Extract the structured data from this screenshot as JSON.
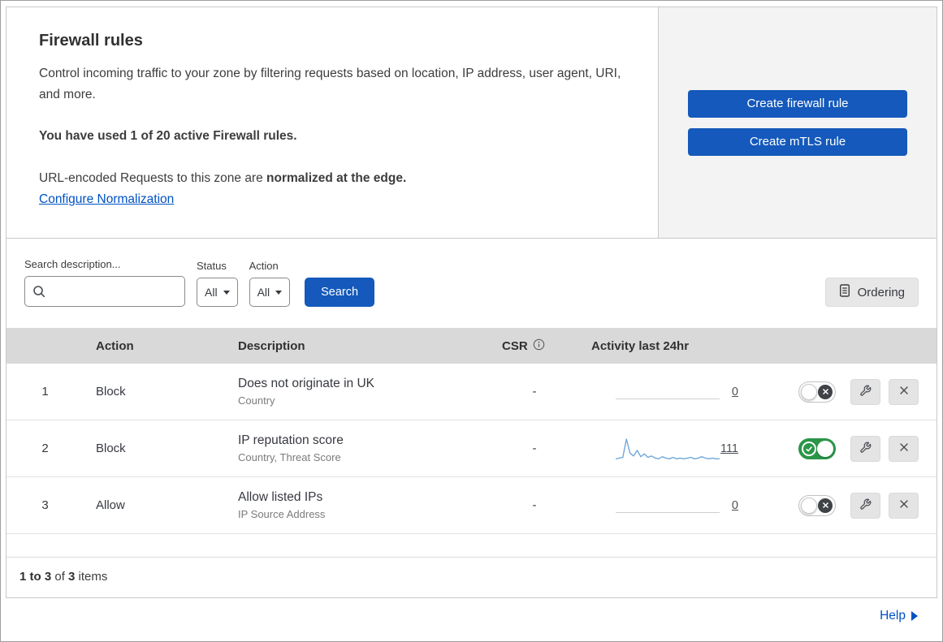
{
  "intro": {
    "title": "Firewall rules",
    "description": "Control incoming traffic to your zone by filtering requests based on location, IP address, user agent, URI, and more.",
    "usage_note": "You have used 1 of 20 active Firewall rules.",
    "normalization_prefix": "URL-encoded Requests to this zone are ",
    "normalization_bold": "normalized at the edge.",
    "normalization_link_label": "Configure Normalization"
  },
  "actions_panel": {
    "create_firewall_rule_label": "Create firewall rule",
    "create_mtls_rule_label": "Create mTLS rule"
  },
  "filters": {
    "search_label": "Search description...",
    "search_value": "",
    "status_label": "Status",
    "status_value": "All",
    "action_label": "Action",
    "action_value": "All",
    "search_button_label": "Search",
    "ordering_button_label": "Ordering"
  },
  "table": {
    "headers": {
      "action": "Action",
      "description": "Description",
      "csr": "CSR",
      "activity": "Activity last 24hr"
    },
    "rows": [
      {
        "num": "1",
        "action": "Block",
        "description": "Does not originate in UK",
        "match_fields": "Country",
        "csr": "-",
        "activity_count": "0",
        "enabled": false,
        "sparkline": []
      },
      {
        "num": "2",
        "action": "Block",
        "description": "IP reputation score",
        "match_fields": "Country, Threat Score",
        "csr": "-",
        "activity_count": "111",
        "enabled": true,
        "sparkline": [
          2,
          3,
          4,
          30,
          10,
          6,
          14,
          5,
          9,
          4,
          6,
          3,
          2,
          5,
          3,
          2,
          4,
          2,
          3,
          2,
          3,
          4,
          2,
          3,
          5,
          3,
          2,
          3,
          2,
          2
        ]
      },
      {
        "num": "3",
        "action": "Allow",
        "description": "Allow listed IPs",
        "match_fields": "IP Source Address",
        "csr": "-",
        "activity_count": "0",
        "enabled": false,
        "sparkline": []
      }
    ]
  },
  "footer": {
    "range": "1 to 3",
    "of_text": " of ",
    "total": "3",
    "items_text": " items"
  },
  "help": {
    "label": "Help"
  },
  "colors": {
    "primary_blue": "#1459bb",
    "link_blue": "#0051c3",
    "toggle_green": "#2a9648",
    "header_gray": "#d9d9d9",
    "panel_gray": "#f3f3f3",
    "sparkline_blue": "#71a8d9"
  }
}
